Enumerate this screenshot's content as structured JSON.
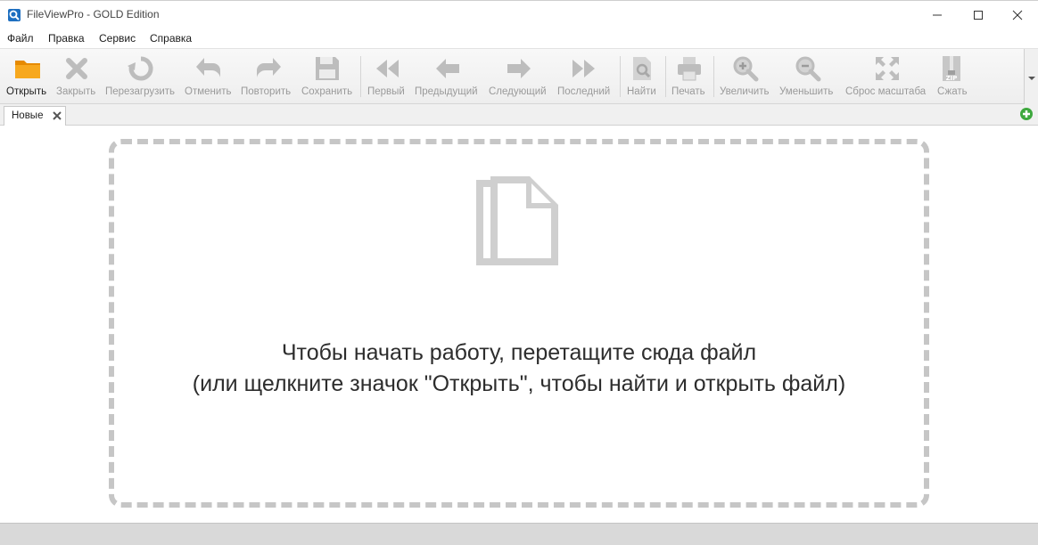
{
  "window": {
    "title": "FileViewPro - GOLD Edition"
  },
  "menu": {
    "items": [
      "Файл",
      "Правка",
      "Сервис",
      "Справка"
    ]
  },
  "toolbar": {
    "buttons": [
      {
        "label": "Открыть",
        "icon": "folder-icon",
        "enabled": true
      },
      {
        "label": "Закрыть",
        "icon": "close-x-icon",
        "enabled": false
      },
      {
        "label": "Перезагрузить",
        "icon": "reload-icon",
        "enabled": false
      },
      {
        "label": "Отменить",
        "icon": "undo-icon",
        "enabled": false
      },
      {
        "label": "Повторить",
        "icon": "redo-icon",
        "enabled": false
      },
      {
        "label": "Сохранить",
        "icon": "save-icon",
        "enabled": false
      },
      {
        "label": "Первый",
        "icon": "first-icon",
        "enabled": false
      },
      {
        "label": "Предыдущий",
        "icon": "previous-icon",
        "enabled": false
      },
      {
        "label": "Следующий",
        "icon": "next-icon",
        "enabled": false
      },
      {
        "label": "Последний",
        "icon": "last-icon",
        "enabled": false
      },
      {
        "label": "Найти",
        "icon": "find-icon",
        "enabled": false
      },
      {
        "label": "Печать",
        "icon": "print-icon",
        "enabled": false
      },
      {
        "label": "Увеличить",
        "icon": "zoom-in-icon",
        "enabled": false
      },
      {
        "label": "Уменьшить",
        "icon": "zoom-out-icon",
        "enabled": false
      },
      {
        "label": "Сброс масштаба",
        "icon": "reset-zoom-icon",
        "enabled": false
      },
      {
        "label": "Сжать",
        "icon": "zip-icon",
        "enabled": false
      }
    ]
  },
  "tabs": [
    {
      "label": "Новые",
      "active": true
    }
  ],
  "main": {
    "message_line1": "Чтобы начать работу, перетащите сюда файл",
    "message_line2": "(или щелкните значок \"Открыть\", чтобы найти и открыть файл)"
  },
  "colors": {
    "accent_folder": "#f4a21c",
    "add_tab_green": "#3ea83e",
    "disabled_icon": "#bdbdbd",
    "dropzone_border": "#c6c6c6"
  }
}
